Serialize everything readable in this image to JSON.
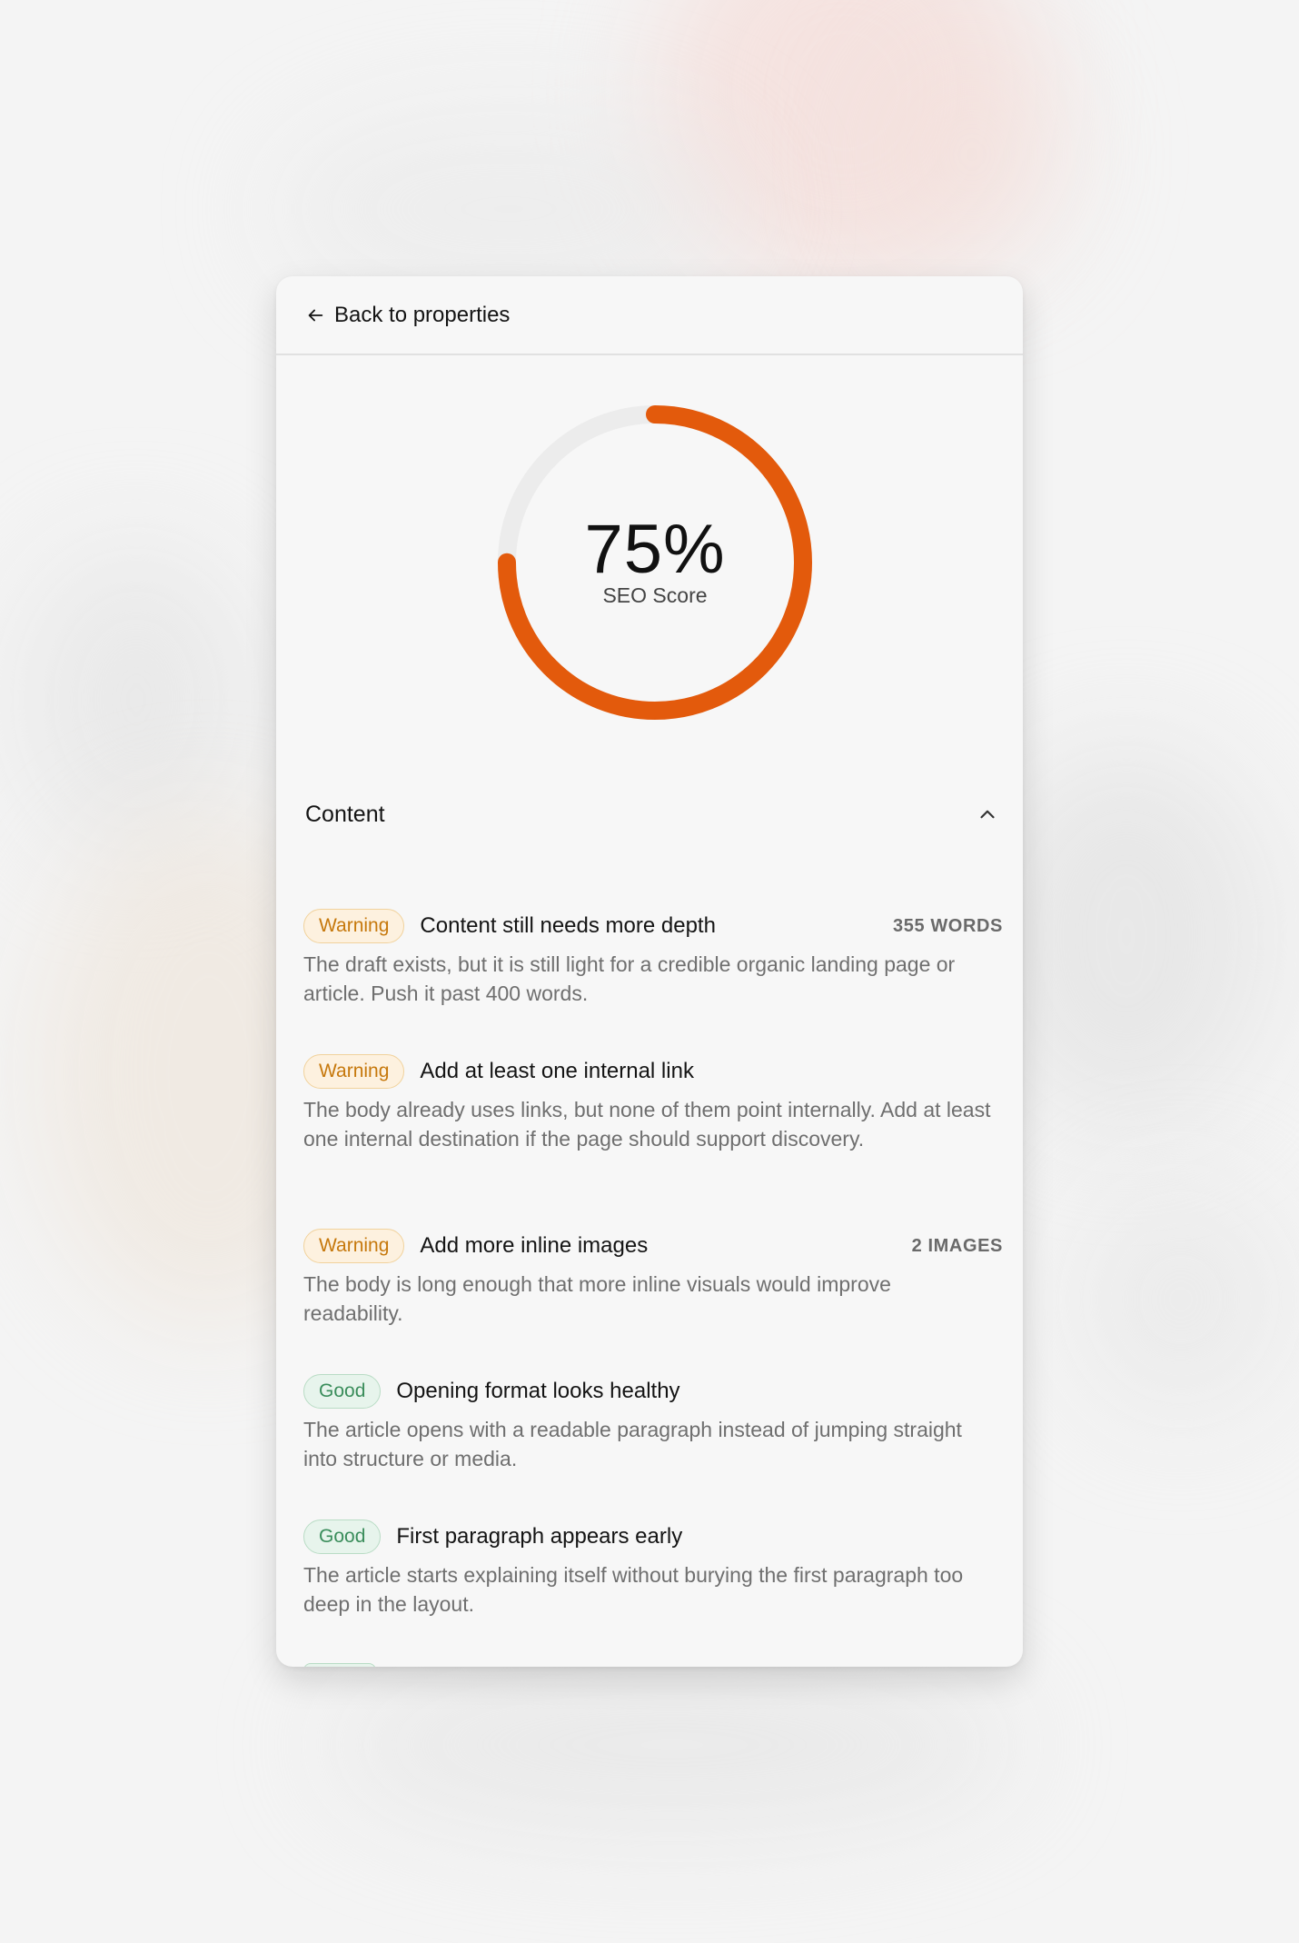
{
  "header": {
    "back_label": "Back to properties"
  },
  "score": {
    "value_text": "75%",
    "value": 0.75,
    "label": "SEO Score",
    "color": "#e35a0c",
    "track_color": "#ececec"
  },
  "section": {
    "title": "Content"
  },
  "checks": [
    {
      "badge": "Warning",
      "status": "warning",
      "title": "Content still needs more depth",
      "meta": "355 WORDS",
      "desc": "The draft exists, but it is still light for a credible organic landing page or article. Push it past 400 words."
    },
    {
      "badge": "Warning",
      "status": "warning",
      "title": "Add at least one internal link",
      "meta": "",
      "desc": "The body already uses links, but none of them point internally. Add at least one internal destination if the page should support discovery."
    },
    {
      "badge": "Warning",
      "status": "warning",
      "title": "Add more inline images",
      "meta": "2 IMAGES",
      "desc": "The body is long enough that more inline visuals would improve readability."
    },
    {
      "badge": "Good",
      "status": "good",
      "title": "Opening format looks healthy",
      "meta": "",
      "desc": "The article opens with a readable paragraph instead of jumping straight into structure or media."
    },
    {
      "badge": "Good",
      "status": "good",
      "title": "First paragraph appears early",
      "meta": "",
      "desc": "The article starts explaining itself without burying the first paragraph too deep in the layout."
    }
  ]
}
